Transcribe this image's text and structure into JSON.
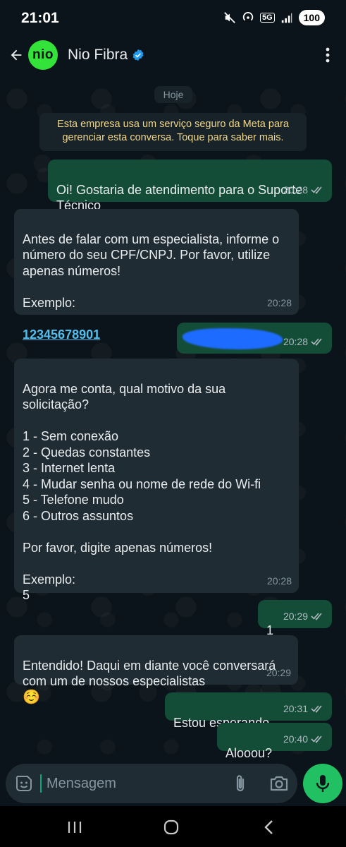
{
  "status_bar": {
    "time": "21:01",
    "network": "5G",
    "battery": "100"
  },
  "header": {
    "avatar_text": "nio",
    "contact_name": "Nio Fibra",
    "accent_color": "#33e33a"
  },
  "chat": {
    "date_label": "Hoje",
    "system_message": "Esta empresa usa um serviço seguro da Meta para gerenciar esta conversa. Toque para saber mais.",
    "messages": [
      {
        "direction": "out",
        "text": "Oi! Gostaria de atendimento para o Suporte Técnico",
        "time": "20:28",
        "status": "read"
      },
      {
        "direction": "in",
        "text": "Antes de falar com um especialista, informe o número do seu CPF/CNPJ. Por favor, utilize apenas números!\n\nExemplo:",
        "link": "12345678901",
        "time": "20:28"
      },
      {
        "direction": "out",
        "text": "",
        "redacted": true,
        "time": "20:28",
        "status": "read"
      },
      {
        "direction": "in",
        "text": "Agora me conta, qual motivo da sua solicitação?\n\n1 - Sem conexão\n2 - Quedas constantes\n3 - Internet lenta\n4 - Mudar senha ou nome de rede do Wi-fi\n5 - Telefone mudo\n6 - Outros assuntos\n\nPor favor, digite apenas números!\n\nExemplo:\n5",
        "time": "20:28"
      },
      {
        "direction": "out",
        "text": "1",
        "time": "20:29",
        "status": "read"
      },
      {
        "direction": "in",
        "text": "Entendido! Daqui em diante você conversará com um de nossos especialistas",
        "emoji": "☺️",
        "time": "20:29"
      },
      {
        "direction": "out",
        "text": "Estou esperando",
        "time": "20:31",
        "status": "read"
      },
      {
        "direction": "out",
        "text": "Alooou?",
        "time": "20:40",
        "status": "read"
      }
    ]
  },
  "input": {
    "placeholder": "Mensagem",
    "value": ""
  },
  "colors": {
    "outgoing_bubble": "#144d37",
    "incoming_bubble": "#202c33",
    "background": "#0b141a",
    "mic_button": "#21c063",
    "link": "#53bdeb"
  },
  "icons": {
    "header": [
      "back-arrow-icon",
      "verified-badge-icon",
      "more-vert-icon"
    ],
    "input": [
      "sticker-icon",
      "paperclip-icon",
      "camera-icon",
      "mic-icon"
    ],
    "nav": [
      "recent-apps-icon",
      "home-icon",
      "nav-back-icon"
    ]
  }
}
